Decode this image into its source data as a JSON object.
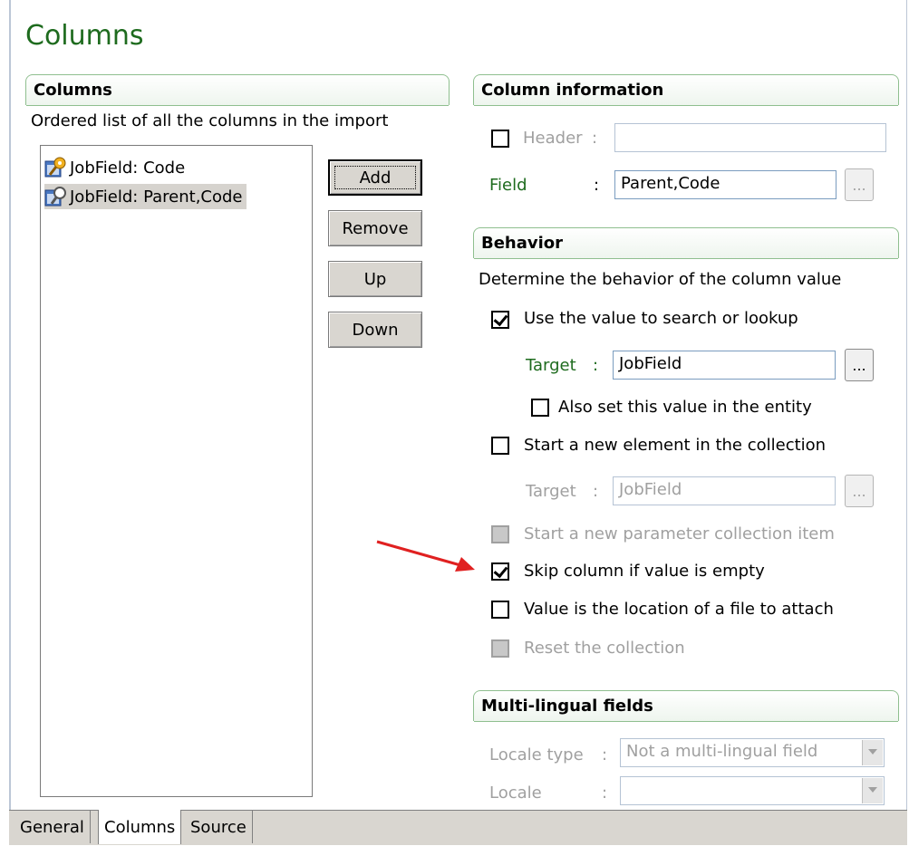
{
  "page_title": "Columns",
  "columns_group": {
    "title": "Columns",
    "description": "Ordered list of all the columns in the import",
    "items": [
      {
        "label": "JobField: Code",
        "icon": "key-icon",
        "selected": false
      },
      {
        "label": "JobField: Parent,Code",
        "icon": "lookup-icon",
        "selected": true
      }
    ],
    "buttons": {
      "add": "Add",
      "remove": "Remove",
      "up": "Up",
      "down": "Down"
    }
  },
  "column_information": {
    "title": "Column information",
    "header_label": "Header",
    "header_value": "",
    "header_checked": false,
    "field_label": "Field",
    "field_value": "Parent,Code",
    "browse_label": "...",
    "colon": ":"
  },
  "behavior": {
    "title": "Behavior",
    "description": "Determine the behavior of the column value",
    "use_value_label": "Use the value to search or lookup",
    "use_value_checked": true,
    "target_label": "Target",
    "target_value": "JobField",
    "also_set_label": "Also set this value in the entity",
    "also_set_checked": false,
    "start_new_label": "Start a new element in the collection",
    "start_new_checked": false,
    "target2_label": "Target",
    "target2_value": "JobField",
    "start_param_label": "Start a new parameter collection item",
    "skip_label": "Skip column if value is empty",
    "skip_checked": true,
    "file_label": "Value is the location of a file to attach",
    "file_checked": false,
    "reset_label": "Reset the collection",
    "browse_label": "..."
  },
  "multilingual": {
    "title": "Multi-lingual fields",
    "locale_type_label": "Locale type",
    "locale_type_value": "Not a multi-lingual field",
    "locale_label": "Locale",
    "locale_value": ""
  },
  "tabs": [
    "General",
    "Columns",
    "Source"
  ],
  "active_tab": "Columns",
  "colors": {
    "accent_green": "#1e6b1e",
    "annotation_red": "#e02020"
  }
}
